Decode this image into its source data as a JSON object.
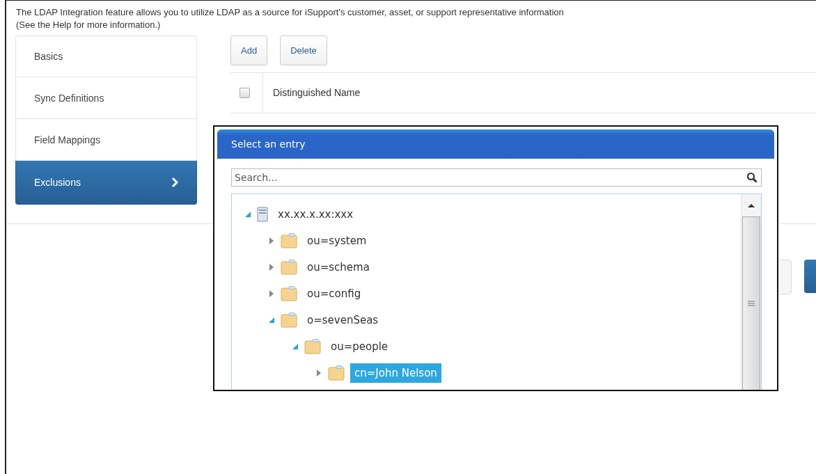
{
  "intro": {
    "text": "The LDAP Integration feature allows you to utilize LDAP as a source for iSupport's customer, asset, or support representative information",
    "help": "(See the Help for more information.)"
  },
  "sidebar": {
    "items": [
      {
        "label": "Basics",
        "selected": false
      },
      {
        "label": "Sync Definitions",
        "selected": false
      },
      {
        "label": "Field Mappings",
        "selected": false
      },
      {
        "label": "Exclusions",
        "selected": true
      }
    ]
  },
  "toolbar": {
    "buttons": [
      "Add",
      "Delete"
    ]
  },
  "table": {
    "columns": [
      {
        "label": "Distinguished Name",
        "checked": false
      }
    ]
  },
  "dialog": {
    "title": "Select an entry",
    "search": {
      "placeholder": "Search..."
    },
    "tree": [
      {
        "label": "xx.xx.x.xx:xxx",
        "kind": "server",
        "expanded": true,
        "selected": false,
        "children": [
          {
            "label": "ou=system",
            "kind": "folder",
            "expanded": false,
            "selected": false
          },
          {
            "label": "ou=schema",
            "kind": "folder",
            "expanded": false,
            "selected": false
          },
          {
            "label": "ou=config",
            "kind": "folder",
            "expanded": false,
            "selected": false
          },
          {
            "label": "o=sevenSeas",
            "kind": "folder",
            "expanded": true,
            "selected": false,
            "children": [
              {
                "label": "ou=people",
                "kind": "folder",
                "expanded": true,
                "selected": false,
                "children": [
                  {
                    "label": "cn=John Nelson",
                    "kind": "folder",
                    "expanded": false,
                    "selected": true
                  }
                ]
              }
            ]
          }
        ]
      }
    ]
  }
}
